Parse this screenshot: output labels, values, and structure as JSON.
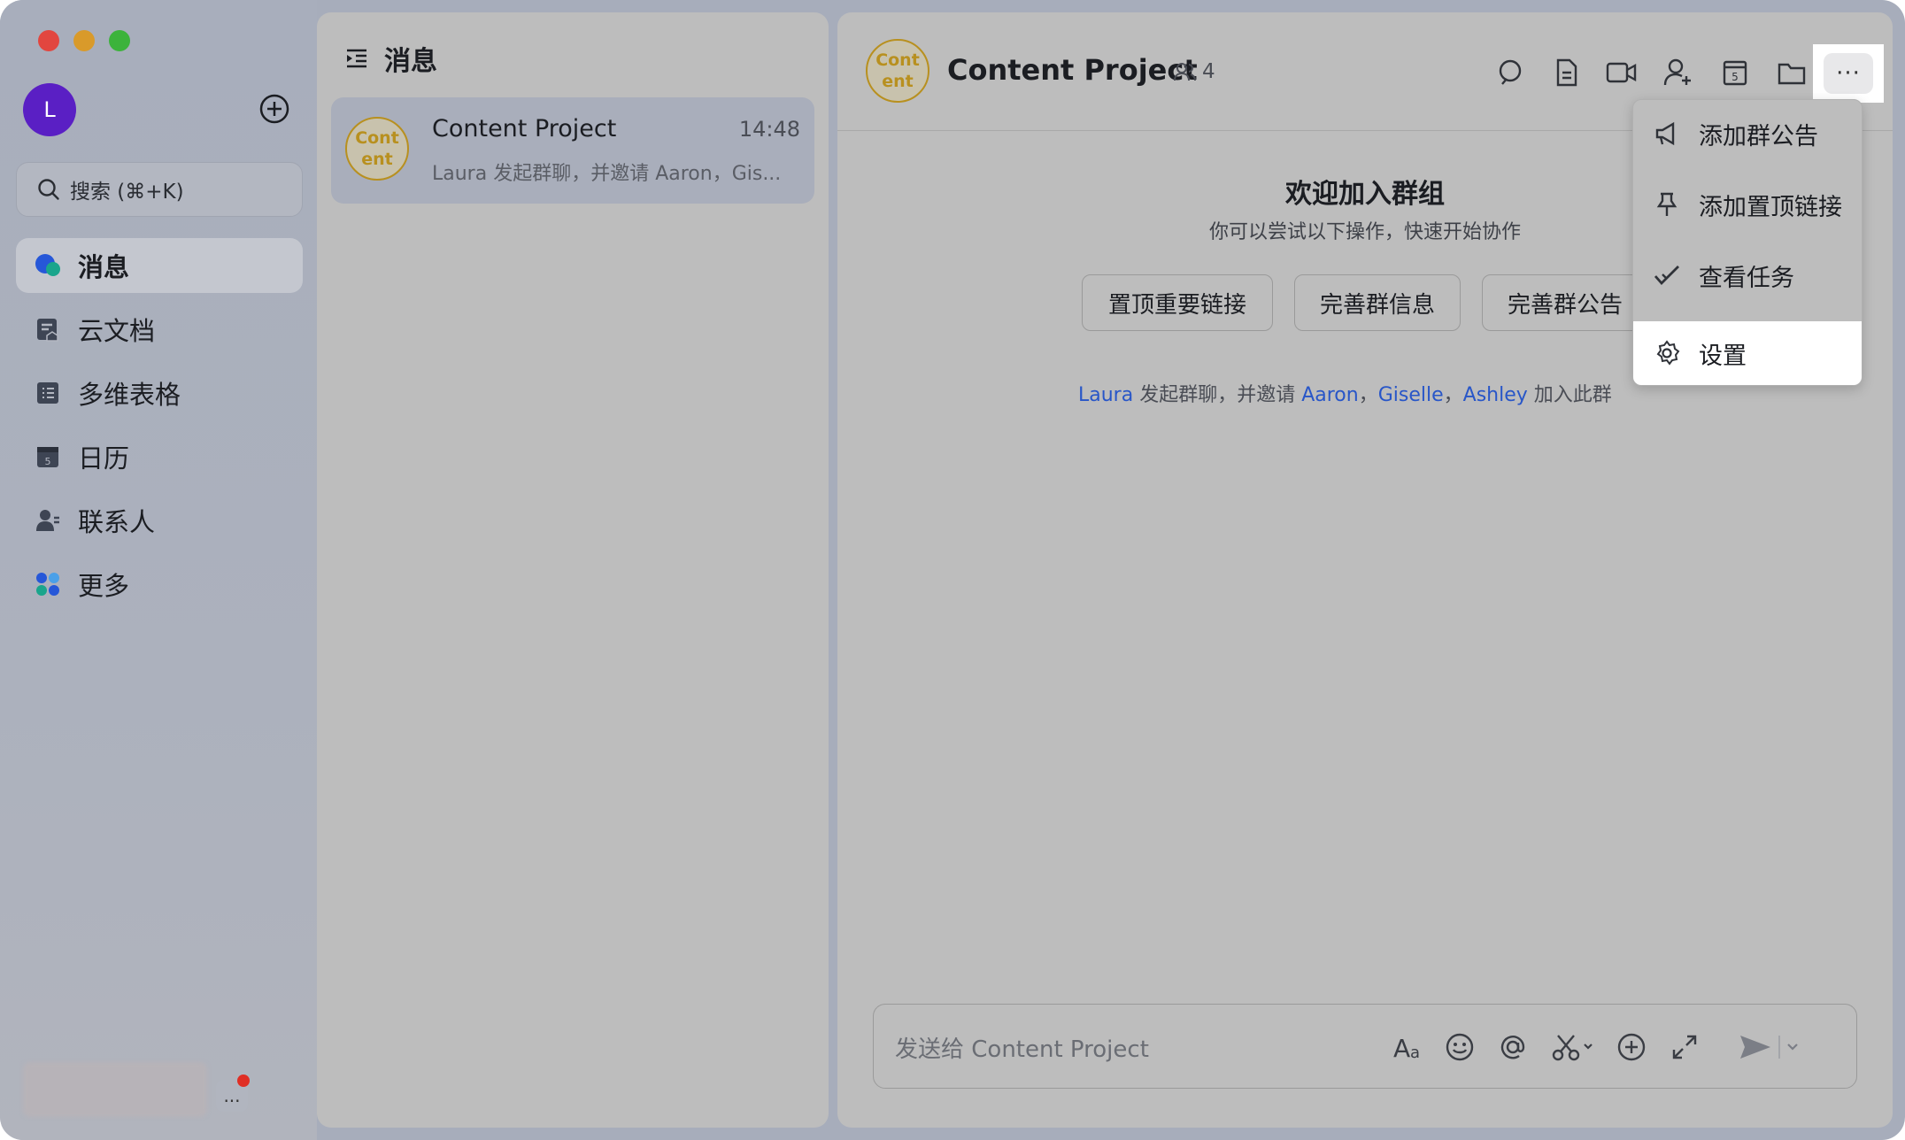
{
  "sidebar": {
    "avatar_initial": "L",
    "search_placeholder": "搜索 (⌘+K)",
    "items": [
      {
        "label": "消息",
        "icon": "chat-bubble-icon",
        "active": true
      },
      {
        "label": "云文档",
        "icon": "doc-icon",
        "active": false
      },
      {
        "label": "多维表格",
        "icon": "table-icon",
        "active": false
      },
      {
        "label": "日历",
        "icon": "calendar-icon",
        "active": false
      },
      {
        "label": "联系人",
        "icon": "contacts-icon",
        "active": false
      },
      {
        "label": "更多",
        "icon": "apps-icon",
        "active": false
      }
    ],
    "more_label": "..."
  },
  "messages": {
    "header": "消息",
    "conversations": [
      {
        "avatar_text": "Cont ent",
        "title": "Content Project",
        "time": "14:48",
        "preview": "Laura 发起群聊，并邀请 Aaron，Gis..."
      }
    ]
  },
  "chat": {
    "avatar_text": "Cont ent",
    "title": "Content Project",
    "member_count": "4",
    "header_icons": [
      "search-icon",
      "doc-icon",
      "video-icon",
      "add-member-icon",
      "calendar-icon",
      "folder-icon",
      "more-icon"
    ],
    "welcome_title": "欢迎加入群组",
    "welcome_subtitle": "你可以尝试以下操作，快速开始协作",
    "actions": [
      "置顶重要链接",
      "完善群信息",
      "完善群公告"
    ],
    "system_message": {
      "creator": "Laura",
      "text1": " 发起群聊，并邀请 ",
      "invitees": [
        "Aaron",
        "Giselle",
        "Ashley"
      ],
      "sep": "，",
      "text2": " 加入此群"
    },
    "input_placeholder": "发送给 Content Project",
    "input_icons": [
      "font-icon",
      "emoji-icon",
      "mention-icon",
      "scissors-icon",
      "add-icon",
      "expand-icon",
      "send-icon"
    ]
  },
  "dropdown": {
    "items": [
      {
        "label": "添加群公告",
        "icon": "megaphone-icon"
      },
      {
        "label": "添加置顶链接",
        "icon": "pin-icon"
      },
      {
        "label": "查看任务",
        "icon": "task-check-icon"
      },
      {
        "label": "设置",
        "icon": "gear-icon"
      }
    ],
    "highlighted_index": 3
  },
  "colors": {
    "accent_link": "#2856c8",
    "avatar_purple": "#5a1fc4",
    "group_avatar_gold": "#b8901f",
    "notification_red": "#e02e24"
  }
}
